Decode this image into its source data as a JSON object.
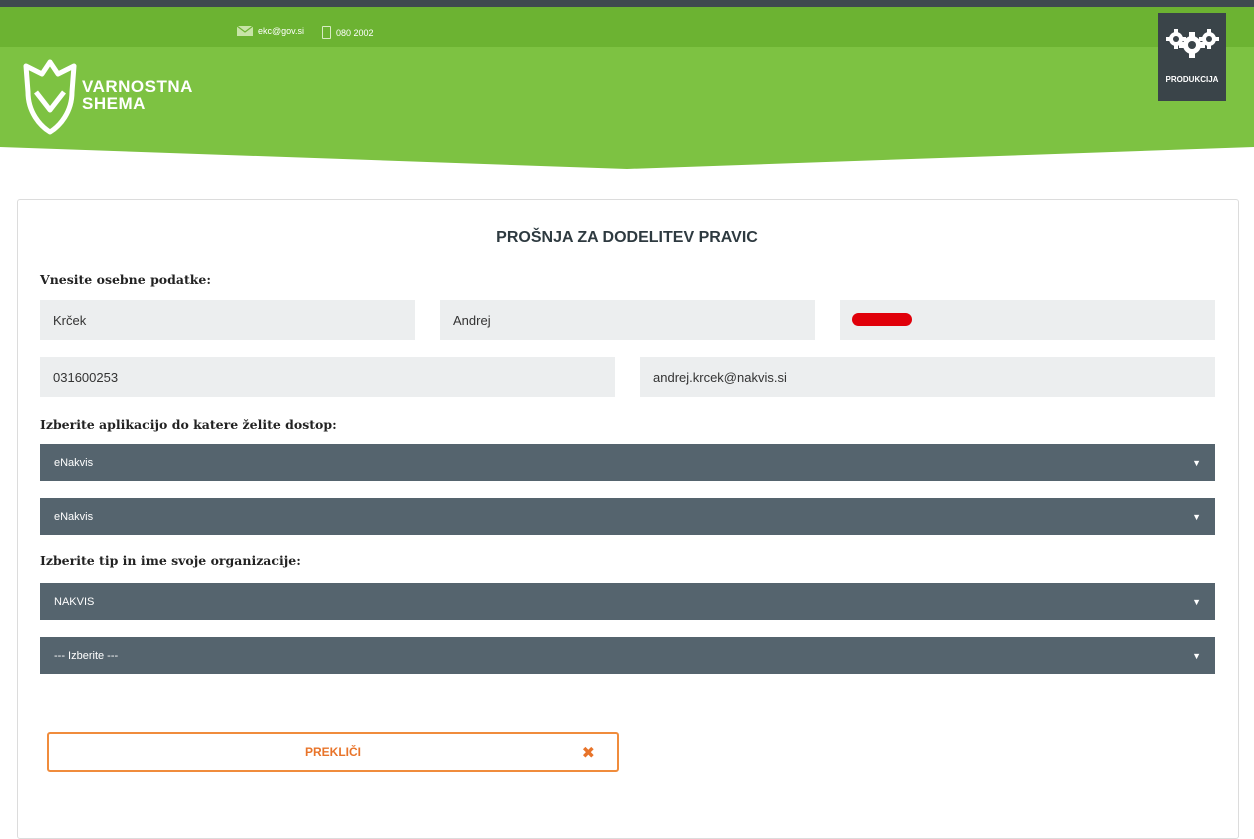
{
  "header": {
    "email": "ekc@gov.si",
    "phone": "080 2002",
    "logo_line1": "VARNOSTNA",
    "logo_line2": "SHEMA",
    "environment_label": "PRODUKCIJA",
    "brand_color": "#7dc242"
  },
  "form": {
    "title": "PROŠNJA ZA DODELITEV PRAVIC",
    "personal_label": "Vnesite osebne podatke:",
    "surname": "Krček",
    "first_name": "Andrej",
    "third_field": "",
    "phone": "031600253",
    "email": "andrej.krcek@nakvis.si",
    "app_label": "Izberite aplikacijo do katere želite dostop:",
    "app_select_1": "eNakvis",
    "app_select_2": "eNakvis",
    "org_label": "Izberite tip in ime svoje organizacije:",
    "org_type": "NAKVIS",
    "org_name": "--- Izberite ---",
    "cancel_label": "PREKLIČI",
    "cancel_icon": "close-icon",
    "accent_color": "#f08c3c"
  }
}
